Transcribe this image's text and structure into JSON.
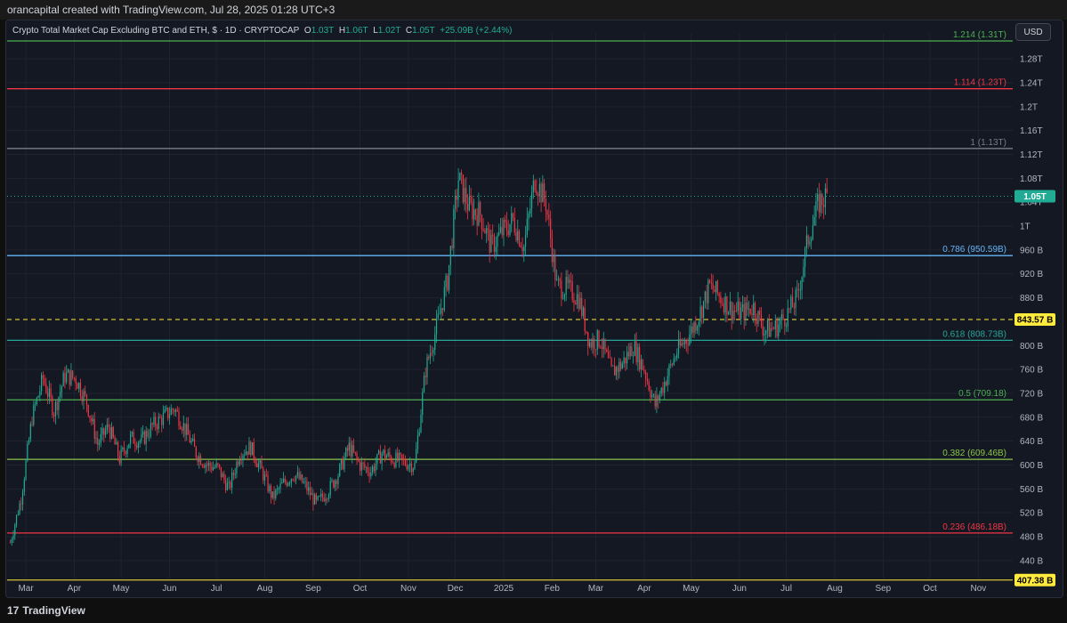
{
  "header": {
    "credit": "orancapital created with TradingView.com, Jul 28, 2025 01:28 UTC+3"
  },
  "legend": {
    "title": "Crypto Total Market Cap Excluding BTC and ETH, $ · 1D · CRYPTOCAP",
    "o_label": "O",
    "o_value": "1.03T",
    "h_label": "H",
    "h_value": "1.06T",
    "l_label": "L",
    "l_value": "1.02T",
    "c_label": "C",
    "c_value": "1.05T",
    "change": "+25.09B (+2.44%)"
  },
  "currency_button": "USD",
  "footer": {
    "brand": "TradingView",
    "brand_mark": "17"
  },
  "colors": {
    "up": "#22ab94",
    "down": "#f23645",
    "background": "#141823"
  },
  "chart_data": {
    "type": "candlestick",
    "title": "Crypto Total Market Cap Excluding BTC and ETH, $ · 1D · CRYPTOCAP",
    "xlabel": "",
    "ylabel": "",
    "ylim": [
      410,
      1310
    ],
    "y_ticks": [
      {
        "v": 440,
        "label": "440 B"
      },
      {
        "v": 480,
        "label": "480 B"
      },
      {
        "v": 520,
        "label": "520 B"
      },
      {
        "v": 560,
        "label": "560 B"
      },
      {
        "v": 600,
        "label": "600 B"
      },
      {
        "v": 640,
        "label": "640 B"
      },
      {
        "v": 680,
        "label": "680 B"
      },
      {
        "v": 720,
        "label": "720 B"
      },
      {
        "v": 760,
        "label": "760 B"
      },
      {
        "v": 800,
        "label": "800 B"
      },
      {
        "v": 880,
        "label": "880 B"
      },
      {
        "v": 920,
        "label": "920 B"
      },
      {
        "v": 960,
        "label": "960 B"
      },
      {
        "v": 1000,
        "label": "1T"
      },
      {
        "v": 1040,
        "label": "1.04T"
      },
      {
        "v": 1080,
        "label": "1.08T"
      },
      {
        "v": 1120,
        "label": "1.12T"
      },
      {
        "v": 1160,
        "label": "1.16T"
      },
      {
        "v": 1200,
        "label": "1.2T"
      },
      {
        "v": 1240,
        "label": "1.24T"
      },
      {
        "v": 1280,
        "label": "1.28T"
      }
    ],
    "x_ticks": [
      "Mar",
      "Apr",
      "May",
      "Jun",
      "Jul",
      "Aug",
      "Sep",
      "Oct",
      "Nov",
      "Dec",
      "2025",
      "Feb",
      "Mar",
      "Apr",
      "May",
      "Jun",
      "Jul",
      "Aug",
      "Sep",
      "Oct",
      "Nov"
    ],
    "fib_levels": [
      {
        "ratio": "1.214",
        "value": 1310,
        "label": "1.214 (1.31T)",
        "color": "#4caf50"
      },
      {
        "ratio": "1.114",
        "value": 1230,
        "label": "1.114 (1.23T)",
        "color": "#f23645"
      },
      {
        "ratio": "1",
        "value": 1130,
        "label": "1 (1.13T)",
        "color": "#787b86"
      },
      {
        "ratio": "0.786",
        "value": 950.59,
        "label": "0.786 (950.59B)",
        "color": "#64b5f6"
      },
      {
        "ratio": "0.618",
        "value": 808.73,
        "label": "0.618 (808.73B)",
        "color": "#26a69a"
      },
      {
        "ratio": "0.5",
        "value": 709.18,
        "label": "0.5 (709.18)",
        "color": "#4caf50"
      },
      {
        "ratio": "0.382",
        "value": 609.46,
        "label": "0.382 (609.46B)",
        "color": "#8bc34a"
      },
      {
        "ratio": "0.236",
        "value": 486.18,
        "label": "0.236 (486.18B)",
        "color": "#f23645"
      }
    ],
    "price_markers": [
      {
        "value": 1050,
        "label": "1.05T",
        "bg": "#22ab94",
        "fg": "#ffffff"
      },
      {
        "value": 843.57,
        "label": "843.57 B",
        "bg": "#ffeb3b",
        "fg": "#000000"
      },
      {
        "value": 407.38,
        "label": "407.38 B",
        "bg": "#ffeb3b",
        "fg": "#000000"
      }
    ],
    "horizontal_lines": [
      {
        "value": 843.57,
        "style": "dashed",
        "color": "#ffeb3b"
      },
      {
        "value": 407.38,
        "style": "solid",
        "color": "#ffeb3b"
      },
      {
        "value": 1050,
        "style": "dotted",
        "color": "#22ab94"
      }
    ],
    "close_path": [
      [
        "2024-02-20",
        470
      ],
      [
        "2024-02-27",
        545
      ],
      [
        "2024-03-05",
        680
      ],
      [
        "2024-03-12",
        745
      ],
      [
        "2024-03-19",
        690
      ],
      [
        "2024-03-26",
        750
      ],
      [
        "2024-04-02",
        745
      ],
      [
        "2024-04-09",
        705
      ],
      [
        "2024-04-16",
        635
      ],
      [
        "2024-04-23",
        665
      ],
      [
        "2024-04-30",
        610
      ],
      [
        "2024-05-07",
        645
      ],
      [
        "2024-05-14",
        640
      ],
      [
        "2024-05-21",
        665
      ],
      [
        "2024-05-28",
        680
      ],
      [
        "2024-06-04",
        695
      ],
      [
        "2024-06-11",
        660
      ],
      [
        "2024-06-18",
        620
      ],
      [
        "2024-06-25",
        600
      ],
      [
        "2024-07-02",
        595
      ],
      [
        "2024-07-09",
        560
      ],
      [
        "2024-07-16",
        620
      ],
      [
        "2024-07-23",
        630
      ],
      [
        "2024-07-30",
        590
      ],
      [
        "2024-08-06",
        545
      ],
      [
        "2024-08-13",
        570
      ],
      [
        "2024-08-20",
        585
      ],
      [
        "2024-08-27",
        565
      ],
      [
        "2024-09-03",
        535
      ],
      [
        "2024-09-10",
        555
      ],
      [
        "2024-09-17",
        585
      ],
      [
        "2024-09-24",
        630
      ],
      [
        "2024-10-01",
        600
      ],
      [
        "2024-10-08",
        590
      ],
      [
        "2024-10-15",
        620
      ],
      [
        "2024-10-22",
        610
      ],
      [
        "2024-10-29",
        605
      ],
      [
        "2024-11-05",
        600
      ],
      [
        "2024-11-12",
        760
      ],
      [
        "2024-11-19",
        830
      ],
      [
        "2024-11-26",
        910
      ],
      [
        "2024-12-03",
        1080
      ],
      [
        "2024-12-10",
        1030
      ],
      [
        "2024-12-17",
        1020
      ],
      [
        "2024-12-24",
        965
      ],
      [
        "2024-12-31",
        990
      ],
      [
        "2025-01-07",
        1010
      ],
      [
        "2025-01-14",
        965
      ],
      [
        "2025-01-21",
        1080
      ],
      [
        "2025-01-28",
        1040
      ],
      [
        "2025-02-04",
        900
      ],
      [
        "2025-02-11",
        895
      ],
      [
        "2025-02-18",
        880
      ],
      [
        "2025-02-25",
        805
      ],
      [
        "2025-03-04",
        810
      ],
      [
        "2025-03-11",
        755
      ],
      [
        "2025-03-18",
        770
      ],
      [
        "2025-03-25",
        800
      ],
      [
        "2025-04-01",
        760
      ],
      [
        "2025-04-08",
        700
      ],
      [
        "2025-04-15",
        745
      ],
      [
        "2025-04-22",
        790
      ],
      [
        "2025-04-29",
        815
      ],
      [
        "2025-05-06",
        850
      ],
      [
        "2025-05-13",
        900
      ],
      [
        "2025-05-20",
        880
      ],
      [
        "2025-05-27",
        860
      ],
      [
        "2025-06-03",
        855
      ],
      [
        "2025-06-10",
        865
      ],
      [
        "2025-06-17",
        825
      ],
      [
        "2025-06-24",
        830
      ],
      [
        "2025-07-01",
        850
      ],
      [
        "2025-07-08",
        880
      ],
      [
        "2025-07-15",
        980
      ],
      [
        "2025-07-22",
        1040
      ],
      [
        "2025-07-27",
        1050
      ]
    ],
    "last_candle": {
      "date": "2025-07-27",
      "open": 1030,
      "high": 1060,
      "low": 1020,
      "close": 1050
    }
  }
}
